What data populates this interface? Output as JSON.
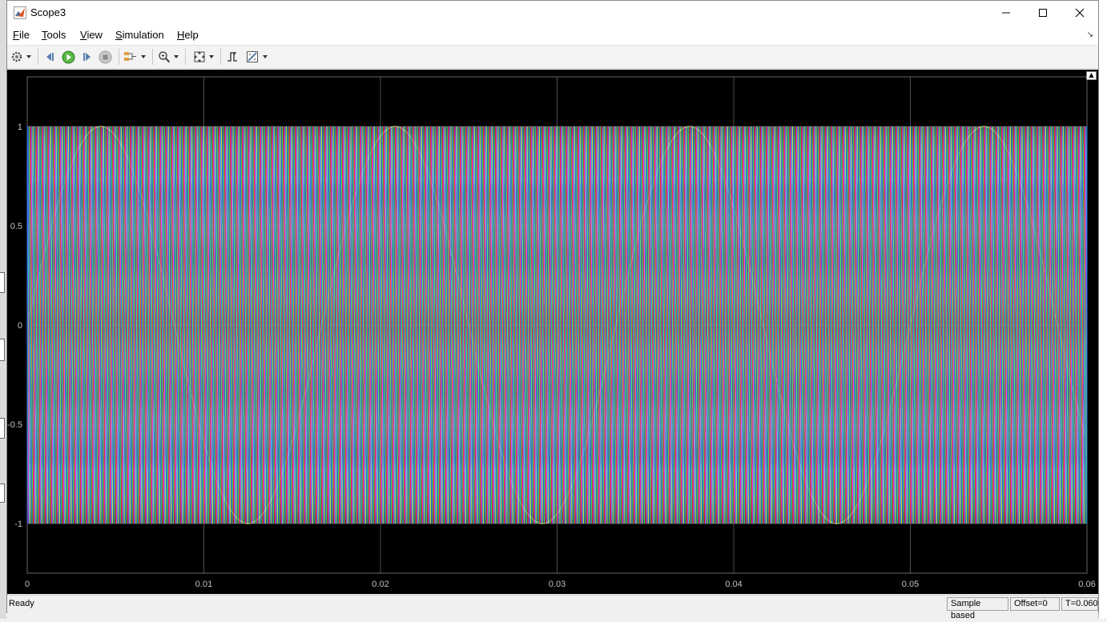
{
  "window": {
    "title": "Scope3"
  },
  "menu": [
    "File",
    "Tools",
    "View",
    "Simulation",
    "Help"
  ],
  "toolbar_icons": [
    "settings-icon",
    "step-back-icon",
    "run-icon",
    "step-forward-icon",
    "stop-icon",
    "signal-selector-icon",
    "zoom-in-icon",
    "fit-to-view-icon",
    "triggers-icon",
    "measurements-icon"
  ],
  "colors": {
    "plot_bg": "#000000",
    "grid": "#4d4d4d",
    "axis_text": "#c0c0c0",
    "sine": "#d9e34a"
  },
  "status": {
    "text": "Ready",
    "mode": "Sample based",
    "offset": "Offset=0",
    "time": "T=0.060"
  },
  "chart_data": {
    "type": "line",
    "title": "",
    "xlabel": "",
    "ylabel": "",
    "xlim": [
      0,
      0.06
    ],
    "ylim": [
      -1.25,
      1.25
    ],
    "x_ticks": [
      "0",
      "0.01",
      "0.02",
      "0.03",
      "0.04",
      "0.05",
      "0.06"
    ],
    "y_ticks": [
      "1",
      "0.5",
      "0",
      "-0.5",
      "-1"
    ],
    "grid": true,
    "series": [
      {
        "kind": "sine",
        "amplitude": 1,
        "frequency_hz": 60,
        "phase_deg": 0,
        "color": "#d9e34a"
      },
      {
        "kind": "triangle_carrier",
        "amplitude": 1,
        "frequency_hz": 3000,
        "phase_fraction": 0.0,
        "color": "#ffff33"
      },
      {
        "kind": "triangle_carrier",
        "amplitude": 1,
        "frequency_hz": 3000,
        "phase_fraction": 0.1667,
        "color": "#33ccff"
      },
      {
        "kind": "triangle_carrier",
        "amplitude": 1,
        "frequency_hz": 3000,
        "phase_fraction": 0.3333,
        "color": "#ff33ff"
      },
      {
        "kind": "triangle_carrier",
        "amplitude": 1,
        "frequency_hz": 3000,
        "phase_fraction": 0.5,
        "color": "#ff3333"
      },
      {
        "kind": "triangle_carrier",
        "amplitude": 1,
        "frequency_hz": 3000,
        "phase_fraction": 0.6667,
        "color": "#33ff66"
      },
      {
        "kind": "triangle_carrier",
        "amplitude": 1,
        "frequency_hz": 3000,
        "phase_fraction": 0.8333,
        "color": "#3366ff"
      }
    ]
  }
}
